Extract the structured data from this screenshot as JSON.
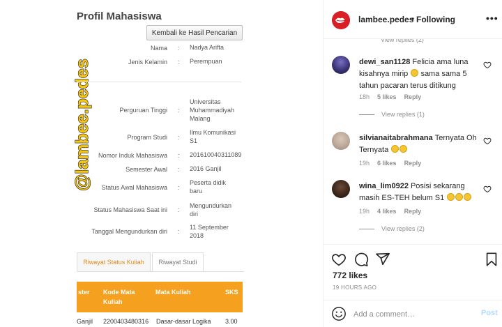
{
  "photo": {
    "title": "Profil Mahasiswa",
    "back_button": "Kembali ke Hasil Pencarian",
    "watermark": "@lambee.pedes",
    "fields": [
      {
        "label": "Nama",
        "value": "Nadya Arifta"
      },
      {
        "label": "Jenis Kelamin",
        "value": "Perempuan"
      },
      {
        "label": "Perguruan Tinggi",
        "value": "Universitas Muhammadiyah Malang"
      },
      {
        "label": "Program Studi",
        "value": "Ilmu Komunikasi S1"
      },
      {
        "label": "Nomor Induk Mahasiswa",
        "value": "201610040311089"
      },
      {
        "label": "Semester Awal",
        "value": "2016 Ganjil"
      },
      {
        "label": "Status Awal Mahasiswa",
        "value": "Peserta didik baru"
      },
      {
        "label": "Status Mahasiswa Saat ini",
        "value": "Mengundurkan diri"
      },
      {
        "label": "Tanggal Mengundurkan diri",
        "value": "11 September 2018"
      }
    ],
    "colon": ":",
    "tabs": [
      "Riwayat Status Kuliah",
      "Riwayat Studi"
    ],
    "table": {
      "headers": [
        "ster",
        "Kode Mata Kuliah",
        "Mata Kuliah",
        "SKS"
      ],
      "row": [
        "Ganjil",
        "2200403480316",
        "Dasar-dasar Logika",
        "3.00"
      ]
    }
  },
  "post": {
    "username": "lambee.pedes",
    "dot": "•",
    "follow_status": "Following",
    "more": "•••",
    "peek_text": "View replies (2)",
    "comments": [
      {
        "user": "dewi_san1128",
        "text": "Felicia ama luna kisahnya mirip",
        "text_after": "sama sama 5 tahun pacaran terus ditikung",
        "time": "18h",
        "likes": "5 likes",
        "reply": "Reply",
        "view_replies": "View replies (1)"
      },
      {
        "user": "silvianaitabrahmana",
        "text": "Ternyata Oh Ternyata",
        "time": "19h",
        "likes": "6 likes",
        "reply": "Reply"
      },
      {
        "user": "wina_lim0922",
        "text": "Posisi sekarang masih ES-TEH belum S1",
        "time": "19h",
        "likes": "4 likes",
        "reply": "Reply",
        "view_replies": "View replies (2)"
      }
    ],
    "likes_count": "772 likes",
    "time_ago": "19 HOURS AGO",
    "add_comment_placeholder": "Add a comment…",
    "post_button": "Post",
    "colors": {
      "brand_red": "#d81f26",
      "table_orange": "#f5a01e",
      "post_disabled": "#b3dbff",
      "muted": "#8e8e8e"
    },
    "icons": [
      "heart-icon",
      "comment-icon",
      "share-icon",
      "bookmark-icon",
      "emoji-icon",
      "more-options-icon"
    ]
  }
}
